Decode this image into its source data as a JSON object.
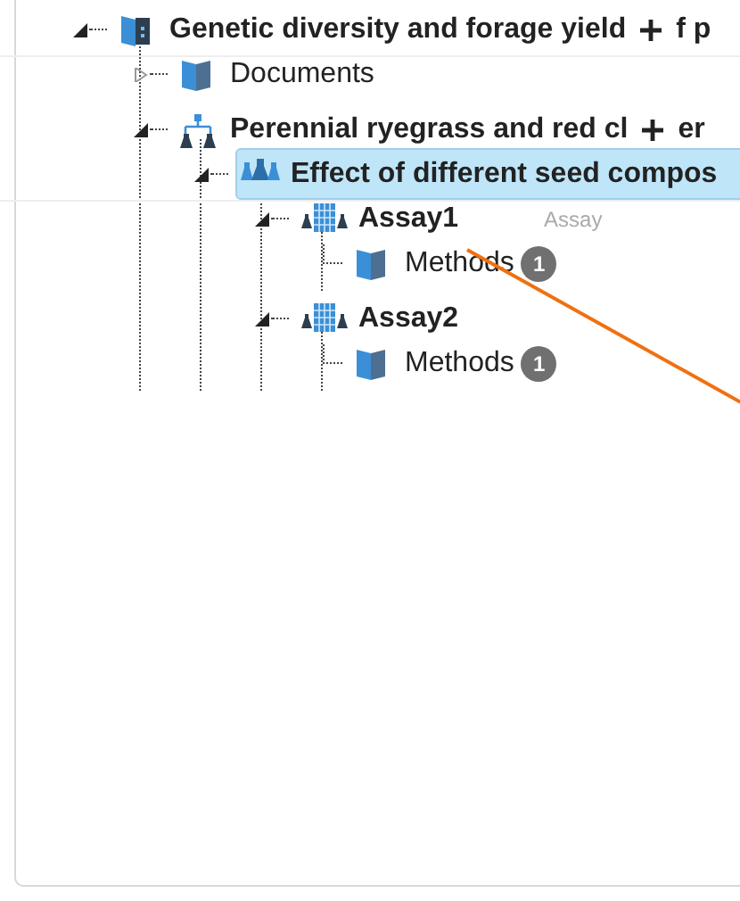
{
  "tree": [
    {
      "kind": "project",
      "label": "Genetic diversity and forage yield",
      "label_tail": "f p",
      "expanded": true,
      "selected": false,
      "children": [
        {
          "kind": "folder",
          "label": "Documents",
          "expanded": false,
          "has_children": true,
          "selected": false
        },
        {
          "kind": "study",
          "label": "Perennial ryegrass and red cl",
          "label_tail": "er",
          "expanded": true,
          "selected": false,
          "children": [
            {
              "kind": "investigation",
              "label": "Effect of different seed compos",
              "expanded": true,
              "selected": true,
              "children": [
                {
                  "kind": "assay",
                  "label": "Assay1",
                  "type_hint": "Assay",
                  "expanded": true,
                  "selected": false,
                  "children": [
                    {
                      "kind": "folder",
                      "label": "Methods",
                      "badge": "1",
                      "selected": false
                    }
                  ]
                },
                {
                  "kind": "assay",
                  "label": "Assay2",
                  "expanded": true,
                  "selected": false,
                  "children": [
                    {
                      "kind": "folder",
                      "label": "Methods",
                      "badge": "1",
                      "selected": false
                    }
                  ]
                }
              ]
            }
          ]
        }
      ]
    }
  ]
}
